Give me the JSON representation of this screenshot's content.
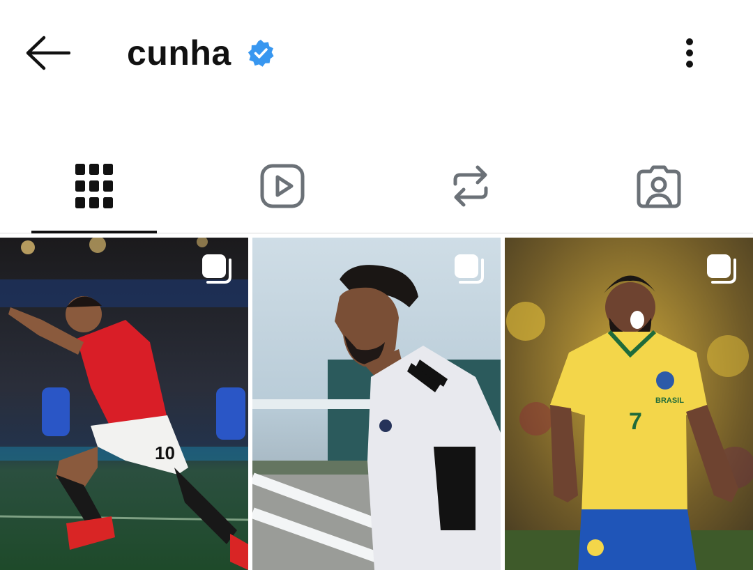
{
  "header": {
    "back_icon": "arrow-left-icon",
    "username": "cunha",
    "verified_icon": "verified-badge-icon",
    "verified_color": "#3897f0",
    "more_icon": "more-vertical-icon"
  },
  "tabs": [
    {
      "name": "posts",
      "icon": "grid-icon",
      "active": true
    },
    {
      "name": "reels",
      "icon": "reels-icon",
      "active": false
    },
    {
      "name": "reposts",
      "icon": "repost-icon",
      "active": false
    },
    {
      "name": "tagged",
      "icon": "tagged-person-icon",
      "active": false
    }
  ],
  "colors": {
    "text": "#111111",
    "inactive_icon": "#6b7177",
    "divider": "#dbdbdb"
  },
  "posts": [
    {
      "type": "carousel",
      "badge_icon": "carousel-icon",
      "number": "10"
    },
    {
      "type": "carousel",
      "badge_icon": "carousel-icon"
    },
    {
      "type": "carousel",
      "badge_icon": "carousel-icon",
      "number": "7",
      "jersey_text": "BRASIL"
    }
  ]
}
